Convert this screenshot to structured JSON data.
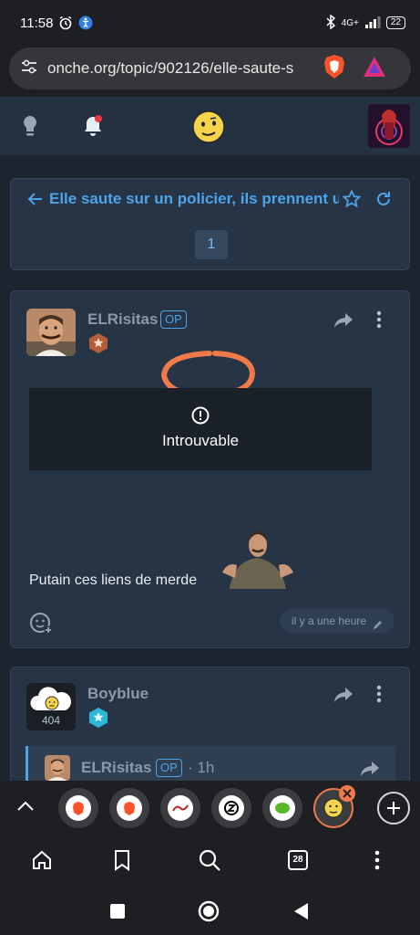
{
  "status_bar": {
    "time": "11:58",
    "network": "4G+",
    "battery": "22"
  },
  "browser": {
    "url": "onche.org/topic/902126/elle-saute-s",
    "tab_count": "28"
  },
  "topic": {
    "title": "Elle saute sur un policier, ils prennent u",
    "page": "1"
  },
  "post1": {
    "author": "ELRisitas",
    "op_label": "OP",
    "embed_status": "Introuvable",
    "body": "Putain ces liens de merde",
    "timestamp": "il y a une heure"
  },
  "post2": {
    "author": "Boyblue",
    "avatar_text": "404",
    "quote": {
      "author": "ELRisitas",
      "op_label": "OP",
      "time": "· 1h"
    }
  },
  "colors": {
    "accent": "#4da3e8",
    "background": "#1c2430",
    "card": "#263445",
    "header": "#243141",
    "annotation_circle": "#f07a4a"
  }
}
